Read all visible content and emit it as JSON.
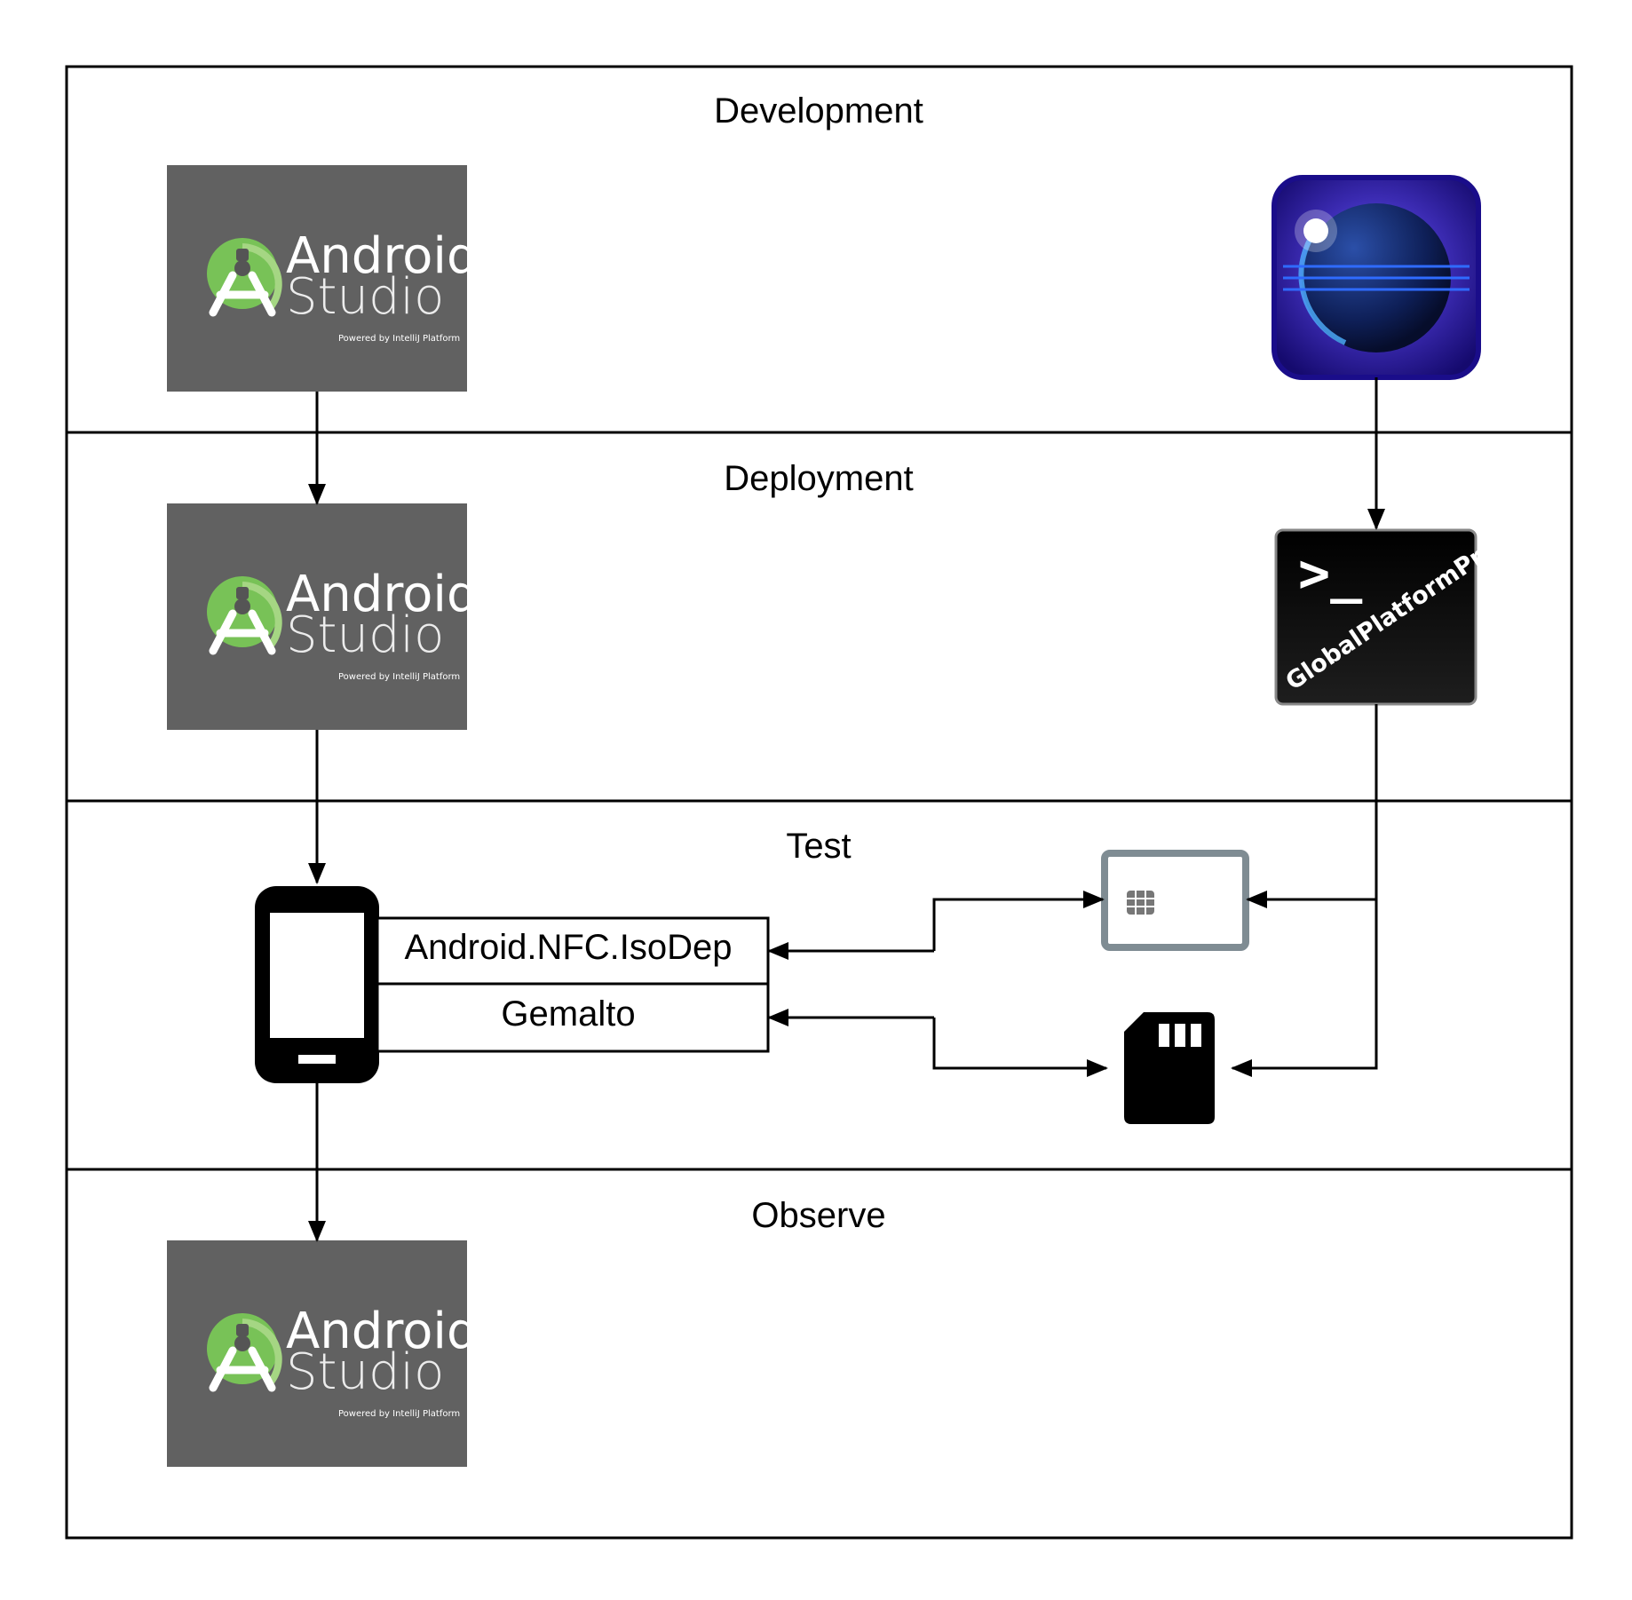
{
  "lanes": [
    {
      "id": "development",
      "title": "Development"
    },
    {
      "id": "deployment",
      "title": "Deployment"
    },
    {
      "id": "test",
      "title": "Test"
    },
    {
      "id": "observe",
      "title": "Observe"
    }
  ],
  "android_studio": {
    "line1": "Android",
    "line2": "Studio",
    "tagline": "Powered by IntelliJ Platform",
    "bg_color": "#616161",
    "logo_color": "#78c257"
  },
  "globalplatformpro": {
    "prompt": ">_",
    "label": "GlobalPlatformPro"
  },
  "api_stack": {
    "top": "Android.NFC.IsoDep",
    "bottom": "Gemalto"
  },
  "icons": {
    "eclipse": "eclipse-icon",
    "phone": "smartphone-icon",
    "smartcard": "smart-card-icon",
    "sim": "sim-card-icon"
  }
}
